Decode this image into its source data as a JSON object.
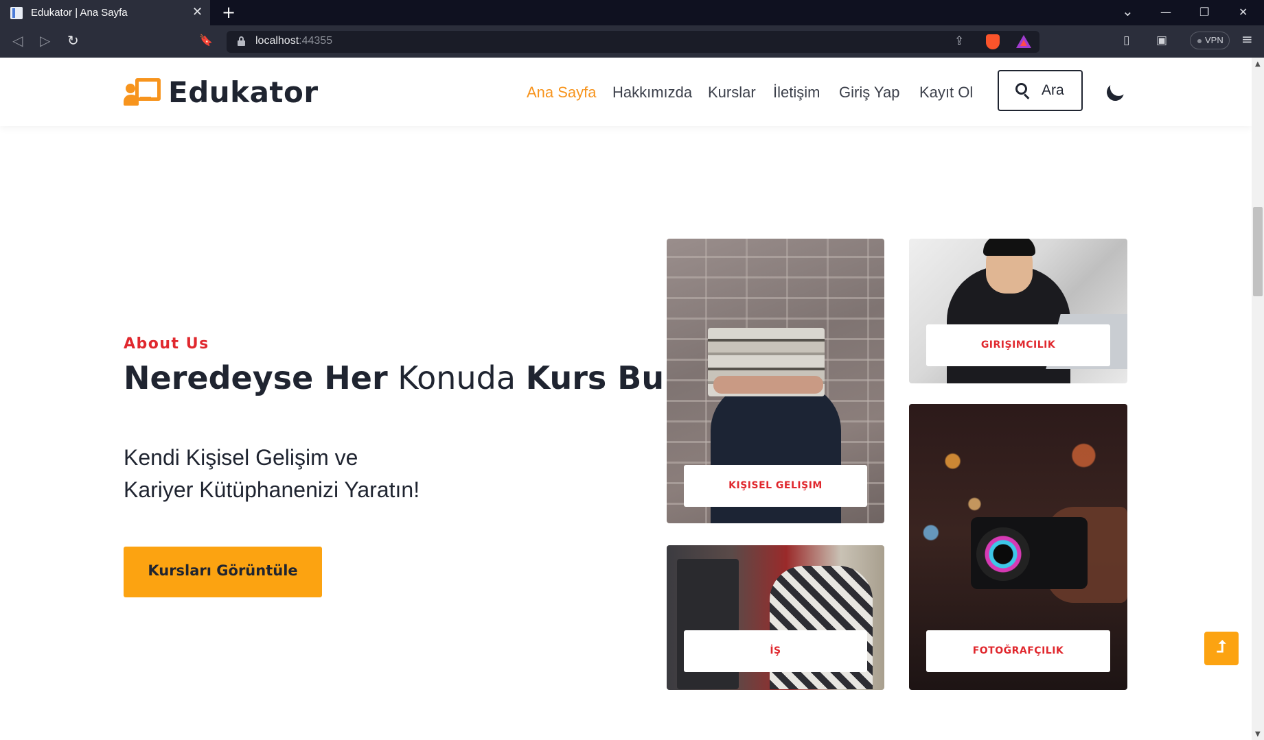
{
  "browser": {
    "tab_title": "Edukator | Ana Sayfa",
    "tab_close": "✕",
    "new_tab": "+",
    "url_host": "localhost",
    "url_port": ":44355",
    "vpn_label": "VPN",
    "controls": {
      "tab_list": "⌄",
      "minimize": "—",
      "restore": "❐",
      "close": "✕"
    },
    "nav": {
      "back": "◁",
      "forward": "▷",
      "reload": "↻",
      "bookmark": "🔖",
      "share": "⇪",
      "sidebar": "▯",
      "wallet": "▣",
      "menu": "≡"
    }
  },
  "header": {
    "logo_text": "Edukator",
    "nav_items": [
      "Ana Sayfa",
      "Hakkımızda",
      "Kurslar",
      "İletişim",
      "Giriş Yap",
      "Kayıt Ol"
    ],
    "search_label": "Ara",
    "accent_color": "#f7941d"
  },
  "hero": {
    "eyebrow": "About Us",
    "headline": {
      "part1": "Neredeyse Her",
      "part2": " Konuda ",
      "part3": "Kurs Bul"
    },
    "subline": {
      "line1": "Kendi Kişisel Gelişim ve",
      "line2": "Kariyer Kütüphanenizi Yaratın!"
    },
    "cta_label": "Kursları Görüntüle",
    "cta_color": "#fca311",
    "eyebrow_color": "#e0282e"
  },
  "categories": [
    {
      "label": "KIŞISEL GELIŞIM"
    },
    {
      "label": "GIRIŞIMCILIK"
    },
    {
      "label": "İŞ"
    },
    {
      "label": "FOTOĞRAFÇILIK"
    }
  ],
  "back_to_top": "⮥"
}
